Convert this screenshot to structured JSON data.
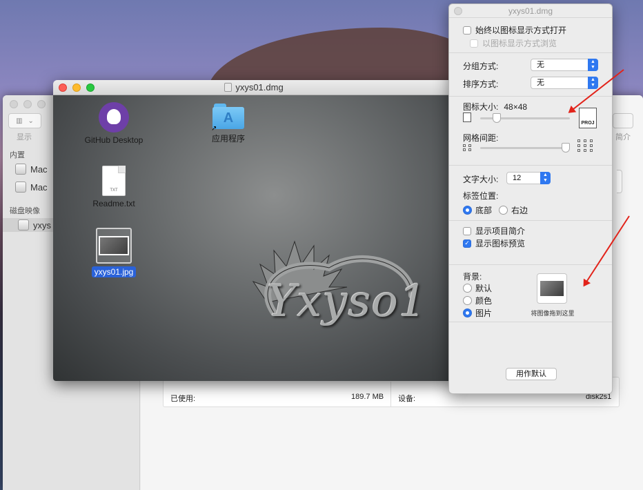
{
  "disk_utility": {
    "toolbar_view_label": "显示",
    "toolbar_info_label": "简介",
    "sections": {
      "internal": "内置",
      "disk_images": "磁盘映像"
    },
    "internal_items": [
      "Mac",
      "Mac"
    ],
    "image_items": [
      "yxys"
    ],
    "info": {
      "used_label": "已使用:",
      "used_value": "189.7 MB",
      "device_label": "设备:",
      "device_value": "disk2s1"
    }
  },
  "finder": {
    "title": "yxys01.dmg",
    "icons": {
      "github": "GitHub Desktop",
      "apps": "应用程序",
      "readme": "Readme.txt",
      "readme_badge": "TXT",
      "jpg": "yxys01.jpg"
    },
    "background_text": "Yxyso1"
  },
  "view_options": {
    "title": "yxys01.dmg",
    "always_open_icon_view": "始终以图标显示方式打开",
    "browse_icon_view": "以图标显示方式浏览",
    "group_by_label": "分组方式:",
    "group_by_value": "无",
    "sort_by_label": "排序方式:",
    "sort_by_value": "无",
    "icon_size_label": "图标大小:",
    "icon_size_value": "48×48",
    "icon_size_fraction": 0.15,
    "grid_spacing_label": "网格间距:",
    "grid_spacing_fraction": 1.0,
    "text_size_label": "文字大小:",
    "text_size_value": "12",
    "label_position_label": "标签位置:",
    "label_bottom": "底部",
    "label_right": "右边",
    "label_position_selected": "bottom",
    "show_item_info": "显示项目简介",
    "show_item_info_checked": false,
    "show_icon_preview": "显示图标预览",
    "show_icon_preview_checked": true,
    "background_label": "背景:",
    "bg_default": "默认",
    "bg_color": "颜色",
    "bg_picture": "图片",
    "background_selected": "picture",
    "drop_image_hint": "将图像拖到这里",
    "use_as_defaults": "用作默认",
    "icon_proj_badge": "PROJ"
  },
  "colors": {
    "accent": "#2f78f0",
    "annotation": "#e2231a",
    "selection": "#2a62d9"
  }
}
